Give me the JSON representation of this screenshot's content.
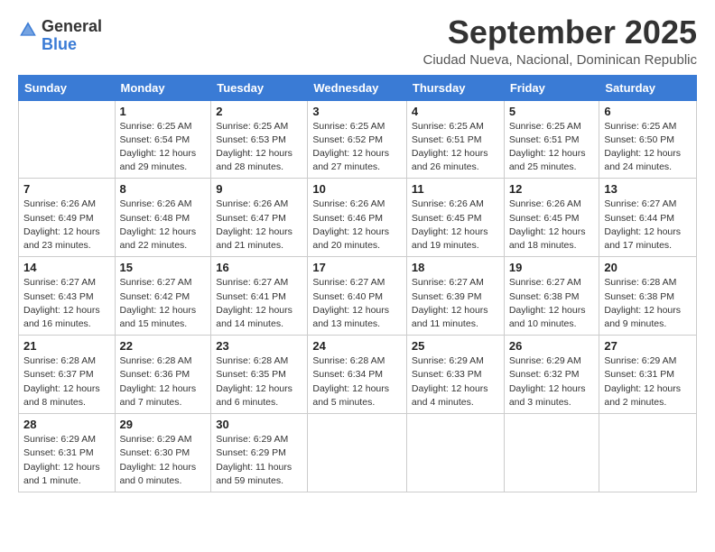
{
  "logo": {
    "general": "General",
    "blue": "Blue"
  },
  "title": "September 2025",
  "subtitle": "Ciudad Nueva, Nacional, Dominican Republic",
  "days_of_week": [
    "Sunday",
    "Monday",
    "Tuesday",
    "Wednesday",
    "Thursday",
    "Friday",
    "Saturday"
  ],
  "weeks": [
    [
      {
        "day": "",
        "info": ""
      },
      {
        "day": "1",
        "info": "Sunrise: 6:25 AM\nSunset: 6:54 PM\nDaylight: 12 hours\nand 29 minutes."
      },
      {
        "day": "2",
        "info": "Sunrise: 6:25 AM\nSunset: 6:53 PM\nDaylight: 12 hours\nand 28 minutes."
      },
      {
        "day": "3",
        "info": "Sunrise: 6:25 AM\nSunset: 6:52 PM\nDaylight: 12 hours\nand 27 minutes."
      },
      {
        "day": "4",
        "info": "Sunrise: 6:25 AM\nSunset: 6:51 PM\nDaylight: 12 hours\nand 26 minutes."
      },
      {
        "day": "5",
        "info": "Sunrise: 6:25 AM\nSunset: 6:51 PM\nDaylight: 12 hours\nand 25 minutes."
      },
      {
        "day": "6",
        "info": "Sunrise: 6:25 AM\nSunset: 6:50 PM\nDaylight: 12 hours\nand 24 minutes."
      }
    ],
    [
      {
        "day": "7",
        "info": "Sunrise: 6:26 AM\nSunset: 6:49 PM\nDaylight: 12 hours\nand 23 minutes."
      },
      {
        "day": "8",
        "info": "Sunrise: 6:26 AM\nSunset: 6:48 PM\nDaylight: 12 hours\nand 22 minutes."
      },
      {
        "day": "9",
        "info": "Sunrise: 6:26 AM\nSunset: 6:47 PM\nDaylight: 12 hours\nand 21 minutes."
      },
      {
        "day": "10",
        "info": "Sunrise: 6:26 AM\nSunset: 6:46 PM\nDaylight: 12 hours\nand 20 minutes."
      },
      {
        "day": "11",
        "info": "Sunrise: 6:26 AM\nSunset: 6:45 PM\nDaylight: 12 hours\nand 19 minutes."
      },
      {
        "day": "12",
        "info": "Sunrise: 6:26 AM\nSunset: 6:45 PM\nDaylight: 12 hours\nand 18 minutes."
      },
      {
        "day": "13",
        "info": "Sunrise: 6:27 AM\nSunset: 6:44 PM\nDaylight: 12 hours\nand 17 minutes."
      }
    ],
    [
      {
        "day": "14",
        "info": "Sunrise: 6:27 AM\nSunset: 6:43 PM\nDaylight: 12 hours\nand 16 minutes."
      },
      {
        "day": "15",
        "info": "Sunrise: 6:27 AM\nSunset: 6:42 PM\nDaylight: 12 hours\nand 15 minutes."
      },
      {
        "day": "16",
        "info": "Sunrise: 6:27 AM\nSunset: 6:41 PM\nDaylight: 12 hours\nand 14 minutes."
      },
      {
        "day": "17",
        "info": "Sunrise: 6:27 AM\nSunset: 6:40 PM\nDaylight: 12 hours\nand 13 minutes."
      },
      {
        "day": "18",
        "info": "Sunrise: 6:27 AM\nSunset: 6:39 PM\nDaylight: 12 hours\nand 11 minutes."
      },
      {
        "day": "19",
        "info": "Sunrise: 6:27 AM\nSunset: 6:38 PM\nDaylight: 12 hours\nand 10 minutes."
      },
      {
        "day": "20",
        "info": "Sunrise: 6:28 AM\nSunset: 6:38 PM\nDaylight: 12 hours\nand 9 minutes."
      }
    ],
    [
      {
        "day": "21",
        "info": "Sunrise: 6:28 AM\nSunset: 6:37 PM\nDaylight: 12 hours\nand 8 minutes."
      },
      {
        "day": "22",
        "info": "Sunrise: 6:28 AM\nSunset: 6:36 PM\nDaylight: 12 hours\nand 7 minutes."
      },
      {
        "day": "23",
        "info": "Sunrise: 6:28 AM\nSunset: 6:35 PM\nDaylight: 12 hours\nand 6 minutes."
      },
      {
        "day": "24",
        "info": "Sunrise: 6:28 AM\nSunset: 6:34 PM\nDaylight: 12 hours\nand 5 minutes."
      },
      {
        "day": "25",
        "info": "Sunrise: 6:29 AM\nSunset: 6:33 PM\nDaylight: 12 hours\nand 4 minutes."
      },
      {
        "day": "26",
        "info": "Sunrise: 6:29 AM\nSunset: 6:32 PM\nDaylight: 12 hours\nand 3 minutes."
      },
      {
        "day": "27",
        "info": "Sunrise: 6:29 AM\nSunset: 6:31 PM\nDaylight: 12 hours\nand 2 minutes."
      }
    ],
    [
      {
        "day": "28",
        "info": "Sunrise: 6:29 AM\nSunset: 6:31 PM\nDaylight: 12 hours\nand 1 minute."
      },
      {
        "day": "29",
        "info": "Sunrise: 6:29 AM\nSunset: 6:30 PM\nDaylight: 12 hours\nand 0 minutes."
      },
      {
        "day": "30",
        "info": "Sunrise: 6:29 AM\nSunset: 6:29 PM\nDaylight: 11 hours\nand 59 minutes."
      },
      {
        "day": "",
        "info": ""
      },
      {
        "day": "",
        "info": ""
      },
      {
        "day": "",
        "info": ""
      },
      {
        "day": "",
        "info": ""
      }
    ]
  ]
}
